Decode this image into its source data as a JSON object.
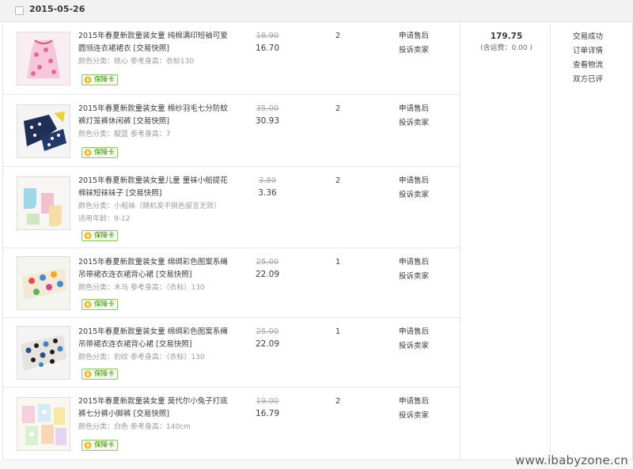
{
  "order": {
    "date": "2015-05-26",
    "total": "179.75",
    "freight": "(含运费：0.00 )",
    "status": {
      "trade_status": "交易成功",
      "order_detail": "订单详情",
      "view_logistics": "查看物流",
      "review": "双方已评"
    }
  },
  "item_actions": {
    "after_sale": "申请售后",
    "complain": "投诉卖家"
  },
  "guarantee_label": "保障卡",
  "items": [
    {
      "title": "2015年春夏新款童装女童 纯棉满印短袖可爱圆领连衣裙裙衣 [交易快照]",
      "spec": "颜色分类：桃心  参考身高：衣标130",
      "orig_price": "18.90",
      "price": "16.70",
      "qty": "2",
      "thumb_icon": "pink-floral-dress-icon"
    },
    {
      "title": "2015年春夏新款童装女童 棉纱羽毛七分防蚊裤灯笼裤休闲裤 [交易快照]",
      "spec": "颜色分类：靛蓝  参考身高：7",
      "orig_price": "35.00",
      "price": "30.93",
      "qty": "2",
      "thumb_icon": "navy-pants-icon"
    },
    {
      "title": "2015年春夏新款童装女童儿童 童袜小船提花棉袜短袜袜子 [交易快照]",
      "spec": "颜色分类：小船袜（随机发不挑色留言无效） 适用年龄：9-12",
      "orig_price": "3.80",
      "price": "3.36",
      "qty": "2",
      "thumb_icon": "socks-icon"
    },
    {
      "title": "2015年春夏新款童装女童 绵绸彩色图案系绳吊带裙衣连衣裙背心裙 [交易快照]",
      "spec": "颜色分类：木马  参考身高：（衣标）130",
      "orig_price": "25.00",
      "price": "22.09",
      "qty": "1",
      "thumb_icon": "print-dress-icon"
    },
    {
      "title": "2015年春夏新款童装女童 绵绸彩色图案系绳吊带裙衣连衣裙背心裙 [交易快照]",
      "spec": "颜色分类：豹纹  参考身高：（衣标）130",
      "orig_price": "25.00",
      "price": "22.09",
      "qty": "1",
      "thumb_icon": "leopard-dress-icon"
    },
    {
      "title": "2015年春夏新款童装女童 莫代尔小兔子打底裤七分裤小脚裤 [交易快照]",
      "spec": "颜色分类：白色  参考身高：140cm",
      "orig_price": "19.00",
      "price": "16.79",
      "qty": "2",
      "thumb_icon": "bunny-leggings-icon"
    }
  ],
  "watermark": "www.ibabyzone.cn"
}
